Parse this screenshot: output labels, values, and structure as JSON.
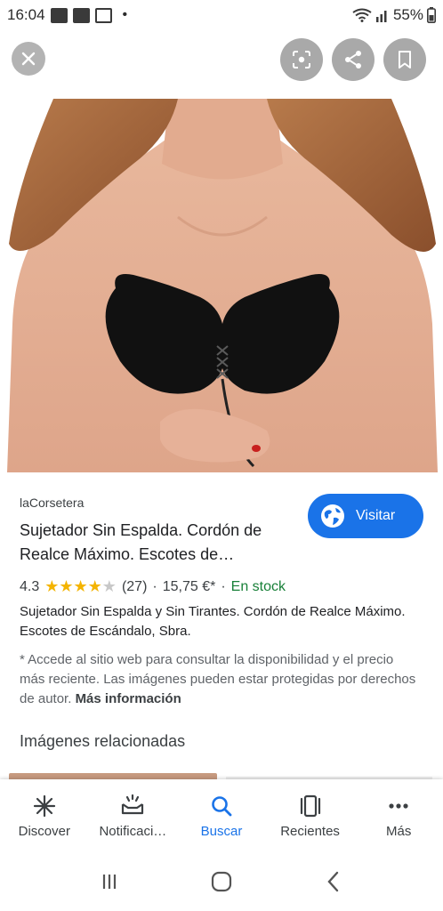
{
  "status_bar": {
    "time": "16:04",
    "battery": "55%",
    "icons": [
      "tiktok-icon",
      "gallery-icon",
      "m-icon",
      "wifi-icon",
      "signal-icon"
    ]
  },
  "hero": {
    "close_icon": "close-icon",
    "lens_icon": "lens-icon",
    "share_icon": "share-icon",
    "bookmark_icon": "bookmark-icon"
  },
  "product": {
    "source": "laCorsetera",
    "title_line1": "Sujetador Sin Espalda. Cordón de",
    "title_line2": "Realce Máximo. Escotes de…",
    "visit_label": "Visitar",
    "rating": "4.3",
    "rating_stars": 4.3,
    "reviews": "(27)",
    "separator": "·",
    "price": "15,75 €*",
    "stock": "En stock",
    "description": "Sujetador Sin Espalda y Sin Tirantes. Cordón de Realce Máximo. Escotes de Escándalo, Sbra.",
    "note": "* Accede al sitio web para consultar la disponibilidad y el precio más reciente. Las imágenes pueden estar protegidas por derechos de autor.",
    "more_info": "Más información",
    "related_title": "Imágenes relacionadas"
  },
  "bottom_nav": [
    {
      "label": "Discover",
      "icon": "discover-icon"
    },
    {
      "label": "Notificaci…",
      "icon": "notifications-icon"
    },
    {
      "label": "Buscar",
      "icon": "search-icon",
      "active": true
    },
    {
      "label": "Recientes",
      "icon": "recents-icon"
    },
    {
      "label": "Más",
      "icon": "more-icon"
    }
  ],
  "colors": {
    "accent": "#1a73e8",
    "stock": "#188038",
    "stars": "#f4b400"
  }
}
